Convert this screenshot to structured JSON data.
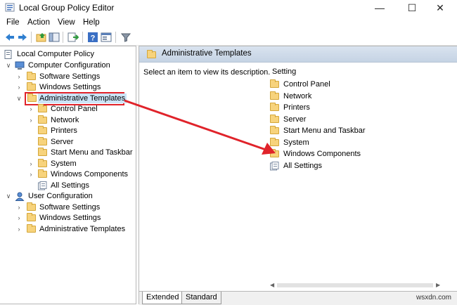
{
  "window": {
    "title": "Local Group Policy Editor",
    "minimize_glyph": "—",
    "maximize_glyph": "☐",
    "close_glyph": "✕"
  },
  "menu": [
    "File",
    "Action",
    "View",
    "Help"
  ],
  "toolbar_icons": [
    "back-icon",
    "forward-icon",
    "up-folder-icon",
    "show-hide-tree-icon",
    "export-list-icon",
    "help-icon",
    "properties-icon",
    "filter-icon"
  ],
  "tree": {
    "root": "Local Computer Policy",
    "computer_config": {
      "label": "Computer Configuration",
      "software": "Software Settings",
      "windows": "Windows Settings",
      "admin": "Administrative Templates",
      "admin_children": [
        "Control Panel",
        "Network",
        "Printers",
        "Server",
        "Start Menu and Taskbar",
        "System",
        "Windows Components",
        "All Settings"
      ]
    },
    "user_config": {
      "label": "User Configuration",
      "software": "Software Settings",
      "windows": "Windows Settings",
      "admin": "Administrative Templates"
    }
  },
  "right_pane": {
    "header": "Administrative Templates",
    "description": "Select an item to view its description.",
    "column": "Setting",
    "items": [
      "Control Panel",
      "Network",
      "Printers",
      "Server",
      "Start Menu and Taskbar",
      "System",
      "Windows Components",
      "All Settings"
    ]
  },
  "tabs": [
    "Extended",
    "Standard"
  ],
  "watermark": "wsxdn.com",
  "colors": {
    "highlight_red": "#e0232a",
    "folder_yellow": "#f7d37c"
  }
}
